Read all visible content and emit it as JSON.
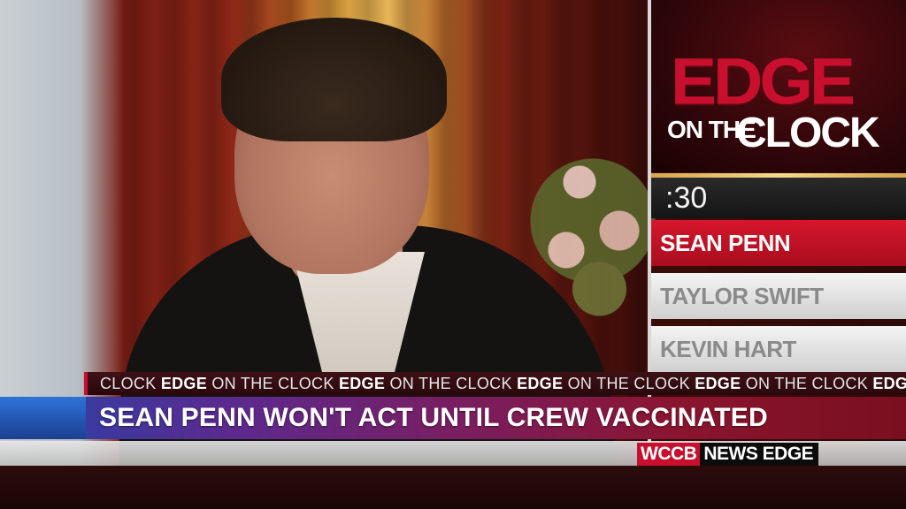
{
  "sidebar": {
    "logo": {
      "line1": "EDGE",
      "line2a": "ON THE",
      "line2b": "CLOCK"
    },
    "timer": ":30",
    "items": [
      {
        "label": "SEAN PENN",
        "active": true
      },
      {
        "label": "TAYLOR SWIFT",
        "active": false
      },
      {
        "label": "KEVIN HART",
        "active": false
      }
    ]
  },
  "ticker": {
    "segments": [
      "CLOCK ",
      "EDGE",
      " ON THE CLOCK ",
      "EDGE",
      " ON THE CLOCK ",
      "EDGE",
      " ON THE CLOCK ",
      "EDGE",
      " ON THE CLOCK ",
      "EDGE"
    ]
  },
  "headline": "SEAN PENN WON'T ACT UNTIL CREW VACCINATED",
  "brand": {
    "part1": "WCCB",
    "part2": "NEWS EDGE"
  },
  "colors": {
    "accent_red": "#c8102e",
    "gold": "#d8a64c",
    "brand_black": "#0c0c0c"
  }
}
